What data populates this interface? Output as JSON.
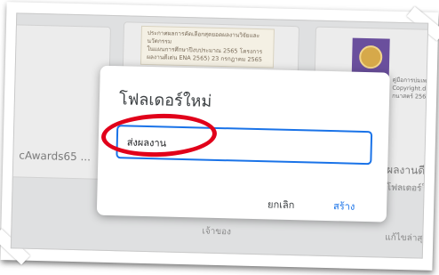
{
  "background": {
    "doc_thumbnail_lines": [
      "ประกาศผลการคัดเลือกสุดยอดผลงานวิจัยและนวัตกรรม",
      "ในแผนการศึกษาปีงบประมาณ 2565 โครงการ",
      "ผลงานดีเด่น ENA 2565) 23 กรกฎาคม 2565"
    ],
    "side_thumbnail_lines": [
      "คู่มือการบ่มเพาะครูเนื้อหางบ",
      "Copyright.dmg (O",
      "กนาสตร์ 2564 ผลงาน"
    ],
    "left_item_label": "cAwards65 ...",
    "right_item_label": "ผลงานดีเด่น",
    "right_item_subtext": "โฟลเดอร์ใหม่",
    "owner_column_label": "เจ้าของ",
    "edited_column_label": "แก้ไขล่าสุด"
  },
  "dialog": {
    "title": "โฟลเดอร์ใหม่",
    "input_value": "ส่งผลงาน",
    "cancel_label": "ยกเลิก",
    "create_label": "สร้าง"
  },
  "colors": {
    "accent_blue": "#1a73e8",
    "annotation_red": "#e1001a",
    "scrim": "#dfe0e1"
  }
}
